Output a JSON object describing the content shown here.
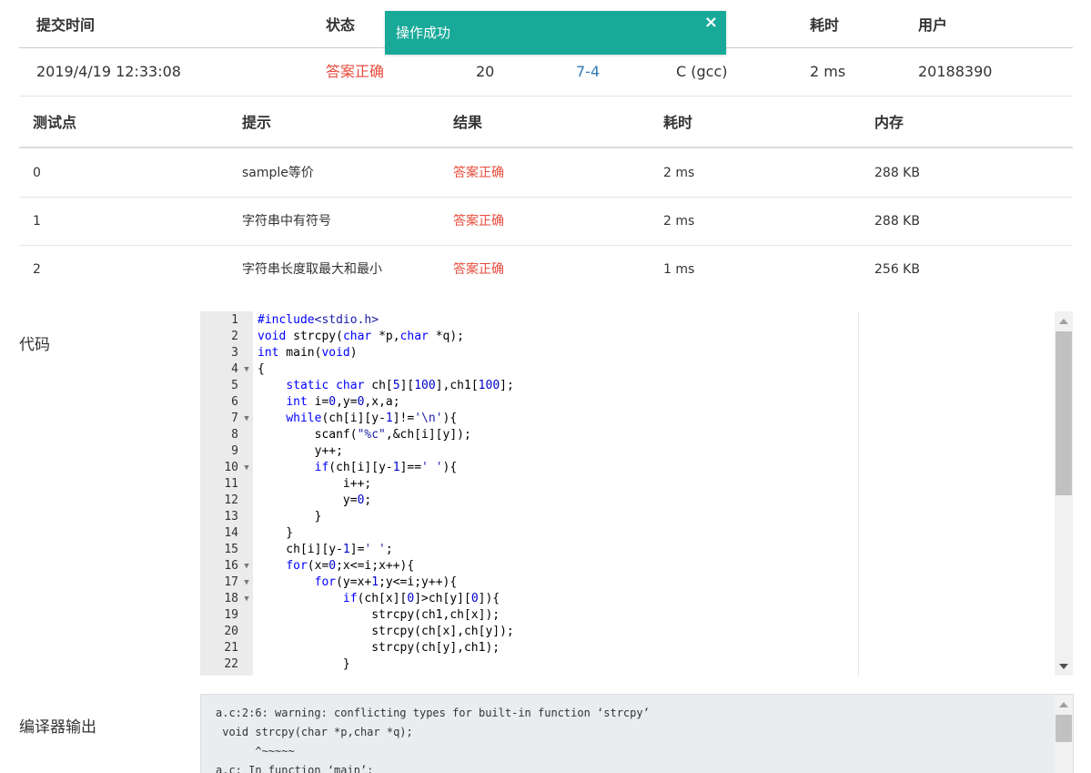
{
  "toast": {
    "message": "操作成功",
    "close_glyph": "×"
  },
  "submission": {
    "headers": [
      "提交时间",
      "状态",
      "耗时",
      "用户"
    ],
    "row": {
      "time": "2019/4/19 12:33:08",
      "status": "答案正确",
      "score": "20",
      "problem": "7-4",
      "compiler": "C (gcc)",
      "duration": "2 ms",
      "user": "20188390"
    }
  },
  "testcases": {
    "headers": [
      "测试点",
      "提示",
      "结果",
      "耗时",
      "内存"
    ],
    "rows": [
      {
        "id": "0",
        "hint": "sample等价",
        "result": "答案正确",
        "time": "2 ms",
        "memory": "288 KB"
      },
      {
        "id": "1",
        "hint": "字符串中有符号",
        "result": "答案正确",
        "time": "2 ms",
        "memory": "288 KB"
      },
      {
        "id": "2",
        "hint": "字符串长度取最大和最小",
        "result": "答案正确",
        "time": "1 ms",
        "memory": "256 KB"
      }
    ]
  },
  "code_label": "代码",
  "compiler_label": "编译器输出",
  "code": {
    "lines": [
      "#include<stdio.h>",
      "void strcpy(char *p,char *q);",
      "int main(void)",
      "{",
      "    static char ch[5][100],ch1[100];",
      "    int i=0,y=0,x,a;",
      "    while(ch[i][y-1]!='\\n'){",
      "        scanf(\"%c\",&ch[i][y]);",
      "        y++;",
      "        if(ch[i][y-1]==' '){",
      "            i++;",
      "            y=0;",
      "        }",
      "    }",
      "    ch[i][y-1]=' ';",
      "    for(x=0;x<=i;x++){",
      "        for(y=x+1;y<=i;y++){",
      "            if(ch[x][0]>ch[y][0]){",
      "                strcpy(ch1,ch[x]);",
      "                strcpy(ch[x],ch[y]);",
      "                strcpy(ch[y],ch1);",
      "            }"
    ],
    "fold_lines": [
      4,
      7,
      10,
      16,
      17,
      18
    ]
  },
  "compiler_output": "a.c:2:6: warning: conflicting types for built-in function ‘strcpy’\n void strcpy(char *p,char *q);\n      ^~~~~~\na.c: In function ‘main’:"
}
